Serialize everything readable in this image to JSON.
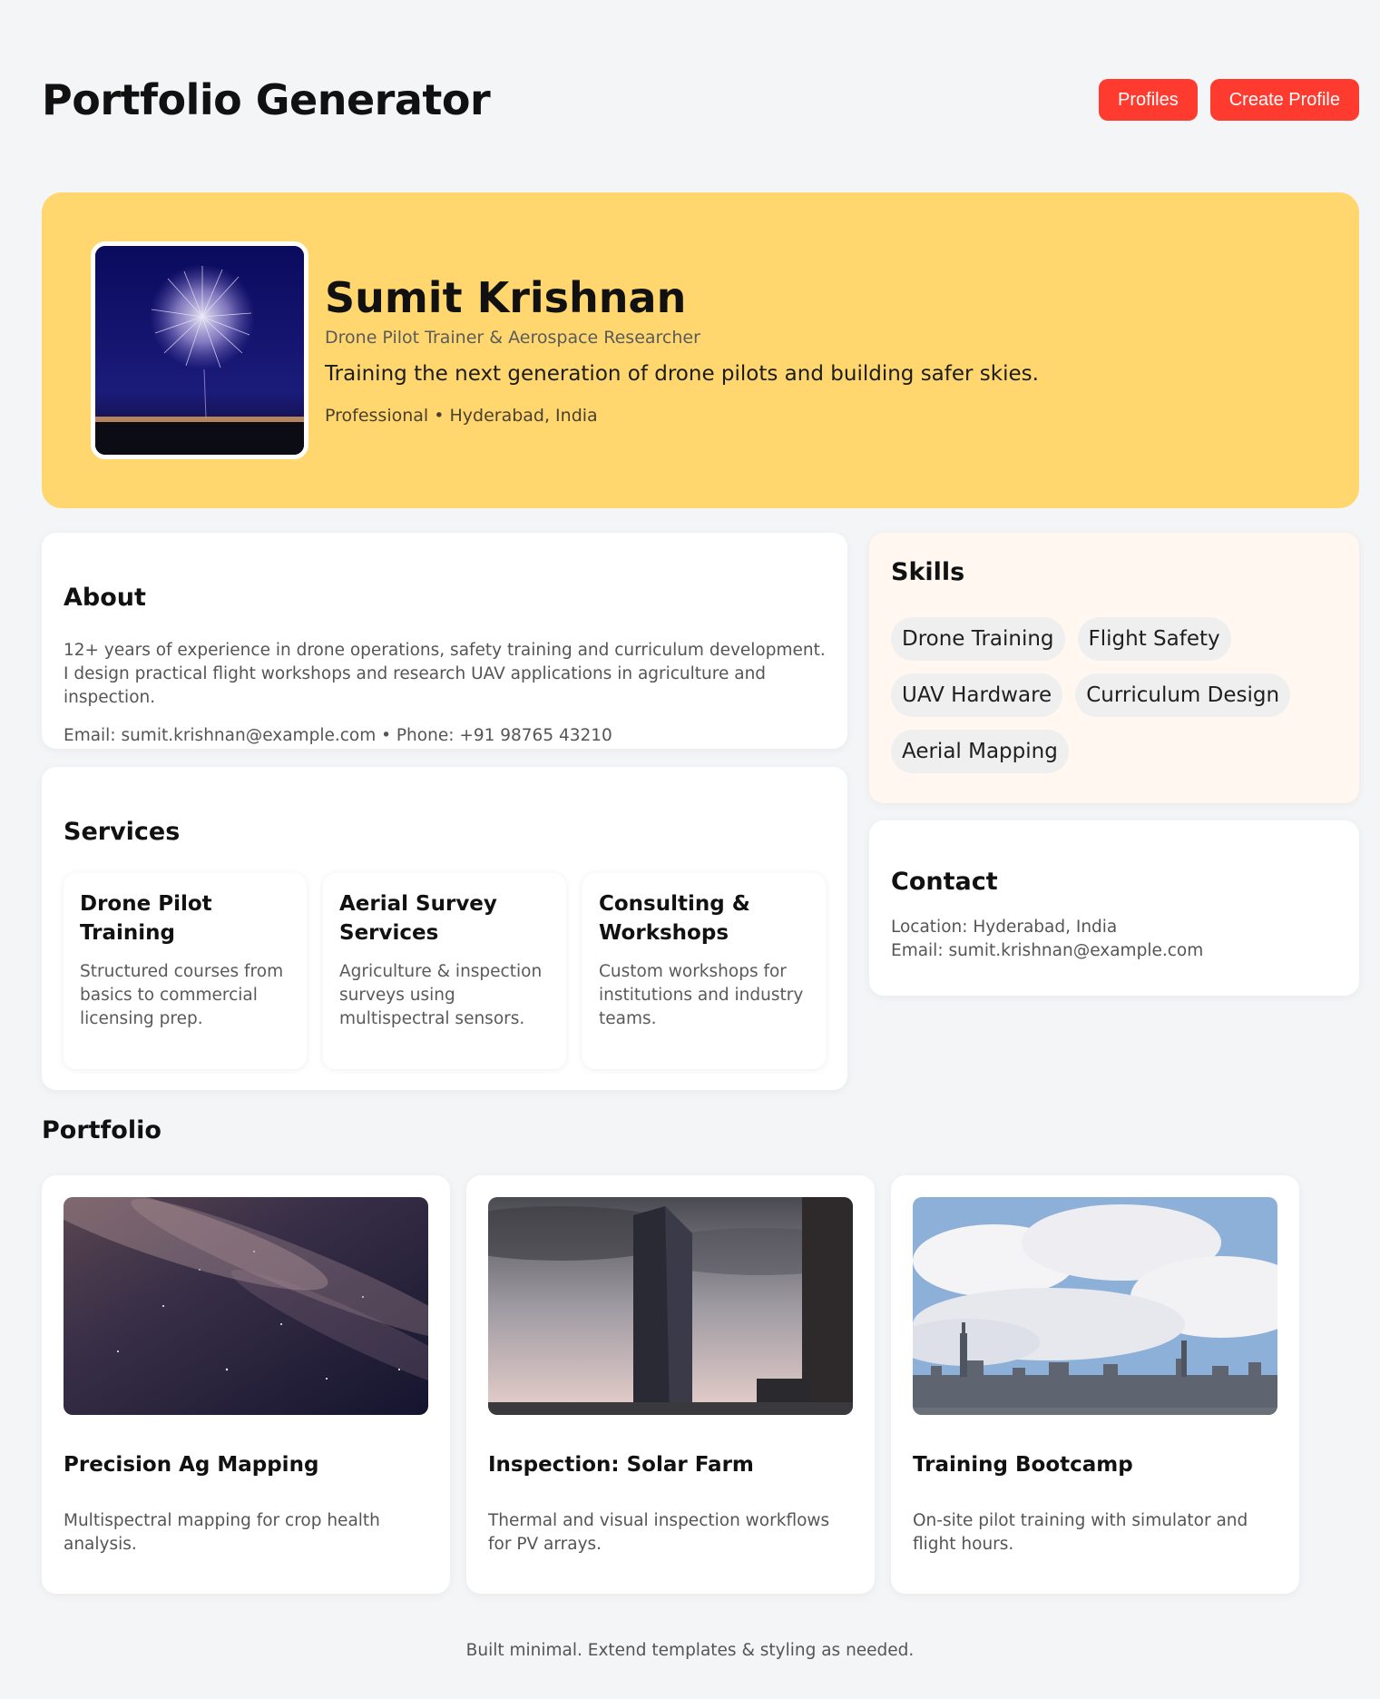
{
  "app": {
    "title": "Portfolio Generator",
    "buttons": {
      "profiles": "Profiles",
      "create_profile": "Create Profile"
    },
    "accent_color": "#ff3b30"
  },
  "profile": {
    "name": "Sumit Krishnan",
    "role": "Drone Pilot Trainer & Aerospace Researcher",
    "tagline": "Training the next generation of drone pilots and building safer skies.",
    "meta": "Professional • Hyderabad, India",
    "hero_color": "#ffd76e"
  },
  "about": {
    "heading": "About",
    "text": "12+ years of experience in drone operations, safety training and curriculum development. I design practical flight workshops and research UAV applications in agriculture and inspection.",
    "contact_line": "Email: sumit.krishnan@example.com • Phone: +91 98765 43210"
  },
  "services": {
    "heading": "Services",
    "items": [
      {
        "title": "Drone Pilot Training",
        "description": "Structured courses from basics to commercial licensing prep."
      },
      {
        "title": "Aerial Survey Services",
        "description": "Agriculture & inspection surveys using multispectral sensors."
      },
      {
        "title": "Consulting & Workshops",
        "description": "Custom workshops for institutions and industry teams."
      }
    ]
  },
  "skills": {
    "heading": "Skills",
    "items": [
      "Drone Training",
      "Flight Safety",
      "UAV Hardware",
      "Curriculum Design",
      "Aerial Mapping"
    ]
  },
  "contact": {
    "heading": "Contact",
    "location": "Location: Hyderabad, India",
    "email": "Email: sumit.krishnan@example.com"
  },
  "portfolio": {
    "heading": "Portfolio",
    "items": [
      {
        "title": "Precision Ag Mapping",
        "description": "Multispectral mapping for crop health analysis."
      },
      {
        "title": "Inspection: Solar Farm",
        "description": "Thermal and visual inspection workflows for PV arrays."
      },
      {
        "title": "Training Bootcamp",
        "description": "On-site pilot training with simulator and flight hours."
      }
    ]
  },
  "footer": {
    "text": "Built minimal. Extend templates & styling as needed."
  }
}
